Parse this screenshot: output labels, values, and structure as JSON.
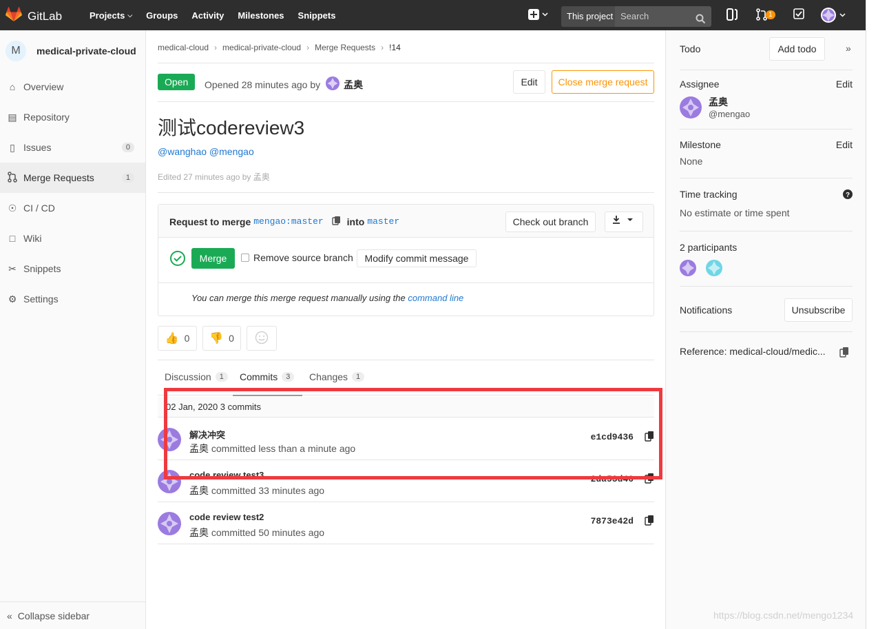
{
  "topnav": {
    "brand": "GitLab",
    "links": [
      "Projects",
      "Groups",
      "Activity",
      "Milestones",
      "Snippets"
    ],
    "scope": "This project",
    "search_placeholder": "Search",
    "mr_count": "1"
  },
  "sidebar": {
    "avatar_letter": "M",
    "project_name": "medical-private-cloud",
    "items": [
      {
        "label": "Overview",
        "icon": "home-icon"
      },
      {
        "label": "Repository",
        "icon": "book-icon"
      },
      {
        "label": "Issues",
        "icon": "issues-icon",
        "count": "0"
      },
      {
        "label": "Merge Requests",
        "icon": "merge-request-icon",
        "count": "1"
      },
      {
        "label": "CI / CD",
        "icon": "rocket-icon"
      },
      {
        "label": "Wiki",
        "icon": "wiki-icon"
      },
      {
        "label": "Snippets",
        "icon": "scissors-icon"
      },
      {
        "label": "Settings",
        "icon": "gear-icon"
      }
    ],
    "collapse": "Collapse sidebar"
  },
  "breadcrumb": [
    "medical-cloud",
    "medical-private-cloud",
    "Merge Requests",
    "!14"
  ],
  "mr": {
    "status": "Open",
    "opened": "Opened 28 minutes ago by",
    "author": "孟奥",
    "edit": "Edit",
    "close": "Close merge request",
    "title": "测试codereview3",
    "mentions": "@wanghao @mengao",
    "edited": "Edited 27 minutes ago by 孟奥"
  },
  "widget": {
    "request_prefix": "Request to merge",
    "source_branch": "mengao:master",
    "into": "into",
    "target_branch": "master",
    "checkout": "Check out branch",
    "merge": "Merge",
    "remove_source": "Remove source branch",
    "modify": "Modify commit message",
    "manual_prefix": "You can merge this merge request manually using the",
    "manual_link": "command line"
  },
  "awards": {
    "thumbsup": "0",
    "thumbsdown": "0"
  },
  "tabs": [
    {
      "label": "Discussion",
      "count": "1"
    },
    {
      "label": "Commits",
      "count": "3"
    },
    {
      "label": "Changes",
      "count": "1"
    }
  ],
  "commits": {
    "day": "02 Jan, 2020 3 commits",
    "items": [
      {
        "title": "解决冲突",
        "author": "孟奥",
        "meta": "committed less than a minute ago",
        "sha": "e1cd9436"
      },
      {
        "title": "code review test3",
        "author": "孟奥",
        "meta": "committed 33 minutes ago",
        "sha": "2da53d46"
      },
      {
        "title": "code review test2",
        "author": "孟奥",
        "meta": "committed 50 minutes ago",
        "sha": "7873e42d"
      }
    ]
  },
  "right": {
    "todo": "Todo",
    "add_todo": "Add todo",
    "assignee": "Assignee",
    "edit": "Edit",
    "assignee_name": "孟奥",
    "assignee_user": "@mengao",
    "milestone": "Milestone",
    "milestone_val": "None",
    "time_tracking": "Time tracking",
    "time_val": "No estimate or time spent",
    "participants": "2 participants",
    "notifications": "Notifications",
    "unsubscribe": "Unsubscribe",
    "reference": "Reference: medical-cloud/medic..."
  },
  "watermark": "https://blog.csdn.net/mengo1234",
  "colors": {
    "green": "#1aaa55",
    "orange": "#fc9403",
    "link": "#1f78d1",
    "highlight": "#ee3a3f"
  }
}
